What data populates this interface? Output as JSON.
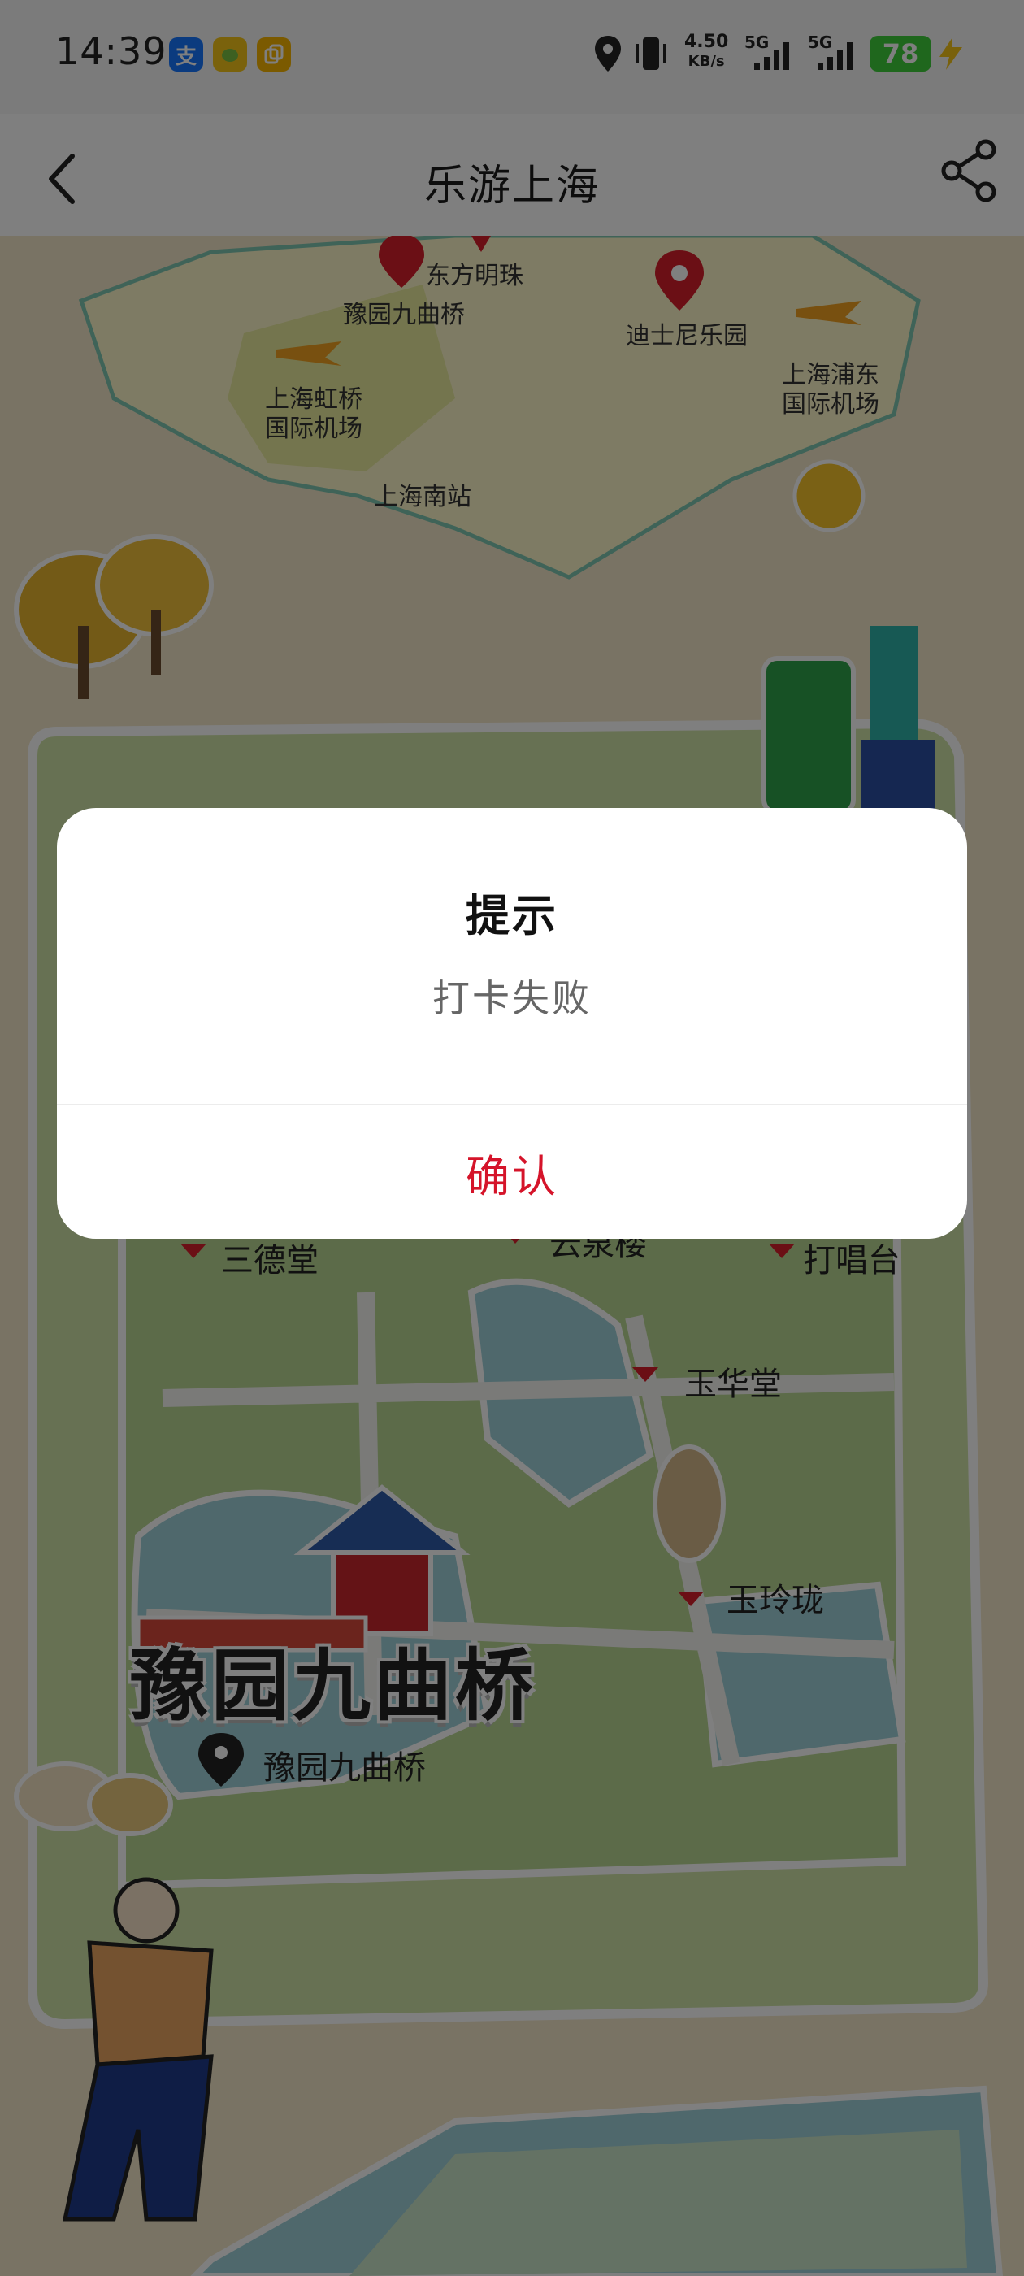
{
  "status_bar": {
    "time": "14:39",
    "net_speed_value": "4.50",
    "net_speed_unit": "KB/s",
    "signal_1": "5G",
    "signal_2": "5G",
    "battery": "78",
    "apps": [
      {
        "name": "alipay-icon",
        "glyph": "支",
        "color": "#1677ff"
      },
      {
        "name": "lemon-app-icon",
        "glyph": "",
        "color": "#f5c518"
      },
      {
        "name": "copy-app-icon",
        "glyph": "",
        "color": "#f7b500"
      }
    ]
  },
  "header": {
    "title": "乐游上海"
  },
  "map": {
    "labels": {
      "dongfang_mingzhu": "东方明珠",
      "yuyuan_jiuqu": "豫园九曲桥",
      "disney": "迪士尼乐园",
      "hongqiao_line1": "上海虹桥",
      "hongqiao_line2": "国际机场",
      "pudong_line1": "上海浦东",
      "pudong_line2": "国际机场",
      "south_station": "上海南站",
      "sande_tang": "三德堂",
      "yunqing_lou": "云泉楼",
      "dachang_tai": "打唱台",
      "yuhua_tang": "玉华堂",
      "yulinglong": "玉玲珑",
      "big_title": "豫园九曲桥",
      "location_label": "豫园九曲桥"
    }
  },
  "dialog": {
    "title": "提示",
    "message": "打卡失败",
    "confirm_label": "确认"
  }
}
